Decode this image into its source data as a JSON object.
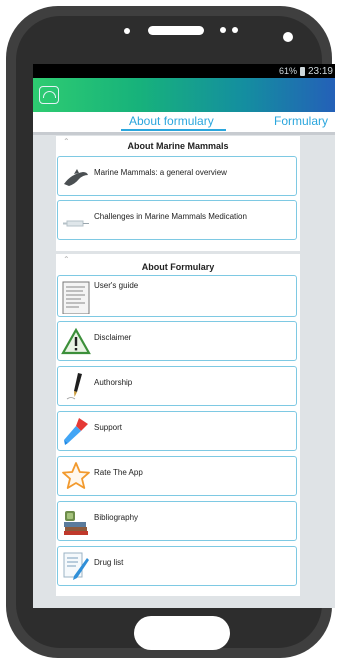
{
  "status": {
    "battery": "61%",
    "time": "23:19"
  },
  "tabs": [
    {
      "label": "About formulary",
      "active": true
    },
    {
      "label": "Formulary",
      "active": false
    }
  ],
  "sections": {
    "marine": {
      "title": "About Marine Mammals",
      "items": [
        {
          "label": "Marine Mammals: a general overview",
          "icon": "dolphin-icon"
        },
        {
          "label": "Challenges in Marine Mammals Medication",
          "icon": "syringe-icon"
        }
      ]
    },
    "formulary": {
      "title": "About Formulary",
      "items": [
        {
          "label": "User's guide",
          "icon": "document-icon"
        },
        {
          "label": "Disclaimer",
          "icon": "warning-icon"
        },
        {
          "label": "Authorship",
          "icon": "pen-icon"
        },
        {
          "label": "Support",
          "icon": "tools-icon"
        },
        {
          "label": "Rate The App",
          "icon": "star-icon"
        },
        {
          "label": "Bibliography",
          "icon": "books-icon"
        },
        {
          "label": "Drug list",
          "icon": "list-icon"
        }
      ]
    }
  },
  "colors": {
    "accent": "#2aa6dd",
    "item_border": "#7ec9e3",
    "appbar_start": "#2ecc71",
    "appbar_end": "#2460b8"
  }
}
